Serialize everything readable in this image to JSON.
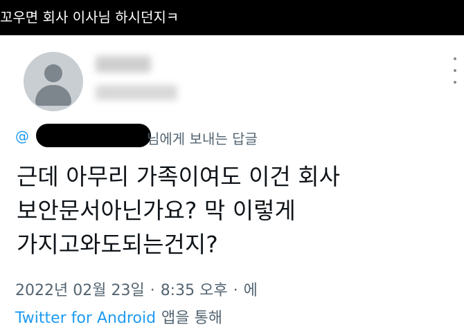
{
  "header": {
    "caption": "꼬우면 회사 이사님 하시던지ㅋ"
  },
  "tweet": {
    "reply_at": "@",
    "reply_suffix": "님에게 보내는 답글",
    "text_lines": [
      "근데 아무리 가족이여도 이건 회사",
      "보안문서아닌가요? 막 이렇게",
      "가지고와도되는건지?"
    ],
    "date": "2022년 02월 23일",
    "time": "8:35 오후",
    "trailing": "에",
    "source_app": "Twitter for Android",
    "source_suffix": "앱을 통해"
  },
  "colors": {
    "link_blue": "#1d9bf0",
    "meta_gray": "#536471",
    "text": "#0f1419"
  },
  "icons": {
    "avatar": "default-profile-icon",
    "more": "more-vertical-icon"
  }
}
